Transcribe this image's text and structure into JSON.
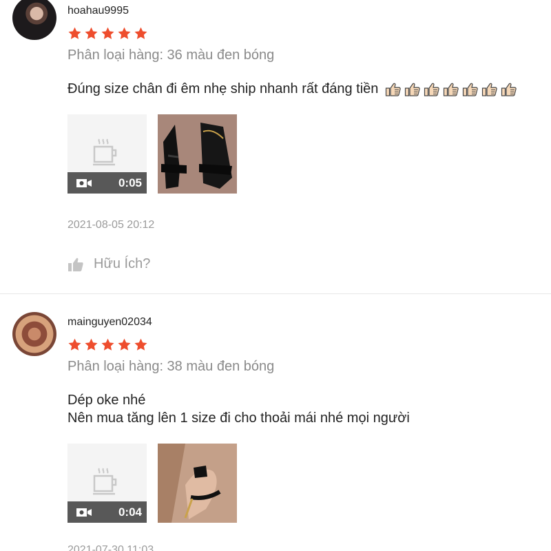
{
  "reviews": [
    {
      "username": "hoahau9995",
      "rating": 5,
      "variation": "Phân loại hàng: 36 màu đen bóng",
      "comment_lines": [
        "Đúng size chân đi êm nhẹ ship nhanh rất đáng tiền"
      ],
      "thumbs_count": 7,
      "video_duration": "0:05",
      "timestamp": "2021-08-05 20:12",
      "helpful_label": "Hữu Ích?"
    },
    {
      "username": "mainguyen02034",
      "rating": 5,
      "variation": "Phân loại hàng: 38 màu đen bóng",
      "comment_lines": [
        "Dép oke nhé",
        "Nên mua tăng lên 1 size đi cho thoải mái nhé mọi người"
      ],
      "video_duration": "0:04",
      "timestamp": "2021-07-30 11:03"
    }
  ],
  "colors": {
    "star": "#ee4d2d",
    "muted_text": "#8a8a8a",
    "divider": "#e8e8e8"
  },
  "icons": {
    "star": "star-icon",
    "video": "video-camera-icon",
    "placeholder": "coffee-cup-icon",
    "like": "thumbs-up-icon"
  }
}
